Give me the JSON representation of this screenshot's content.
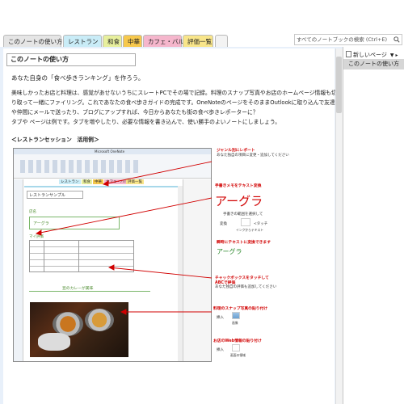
{
  "tabs": [
    {
      "label": "このノートの使い方",
      "color": "#e5e5e5"
    },
    {
      "label": "レストラン",
      "color": "#c9ecf7"
    },
    {
      "label": "和食",
      "color": "#e7ef9d"
    },
    {
      "label": "中華",
      "color": "#f6c84c"
    },
    {
      "label": "カフェ・バル",
      "color": "#f5b6cc"
    },
    {
      "label": "評価一覧",
      "color": "#f8e58a"
    }
  ],
  "search": {
    "placeholder": "すべてのノートブックの検索 (Ctrl+E)"
  },
  "page": {
    "title": "このノートの使い方",
    "lines": [
      "あなた自身の「食べ歩きランキング」を作ろう。",
      "美味しかったお店と料理は、感覚があせないうちにスレートPCでその場で記録。料理のスナップ写真やお店のホームページ情報も切",
      "り取って一緒にファイリング。これであなたの食べ歩きガイドの完成です。OneNoteのページをそのままOutlookに取り込んで友達",
      "や仲間にメールで送ったり、ブログにアップすれば、今日からあなたも街の食べ歩きレポーターに？",
      "タブや ページは例です。タブを増やしたり、必要な情報を書き込んで、使い勝手のよいノートにしましょう。"
    ],
    "section_label": "＜レストランセッション　活用例＞"
  },
  "right_panel": {
    "new_page": "新しいページ",
    "page_item": "このノートの使い方"
  },
  "screenshot": {
    "app_title": "Microsoft OneNote",
    "page_heading": "レストランサンプル",
    "store_label": "店名",
    "store_value": "アーグラ",
    "my_eval": "マイ評価",
    "curry_caption": "豆のカレーが美味",
    "mini_tabs": [
      "レストラン",
      "和食",
      "中華",
      "カフェ・バル",
      "評価一覧"
    ]
  },
  "annotations": {
    "n1_title": "ジャンル別にレポート",
    "n1_sub": "あなた独自の項目に変更・追加してください",
    "n2_title": "手書きメモをテキスト変換",
    "n2_hand": "アーグラ",
    "n2_sub": "手書きの範囲を選択して",
    "n2_convert": "変換",
    "n2_touch": "<タッチ",
    "n2_ink": "インクからテキスト",
    "n2_note": "瞬時にテキストに変換できます",
    "n2_result": "アーグラ",
    "n3_title": "チャックボックスをタッチして",
    "n3_sub1": "ABCで評価",
    "n3_sub2": "あなた独自の評価も追加してください",
    "n4_title": "料理のスナップ写真の貼り付け",
    "n4_insert": "挿入",
    "n4_image": "画像",
    "n5_title": "お店のWeb情報の貼り付け",
    "n5_insert": "挿入",
    "n5_clip": "画面の領域"
  },
  "colors": {
    "accent_red": "#d10000",
    "page_blue": "#e8f0fa"
  }
}
